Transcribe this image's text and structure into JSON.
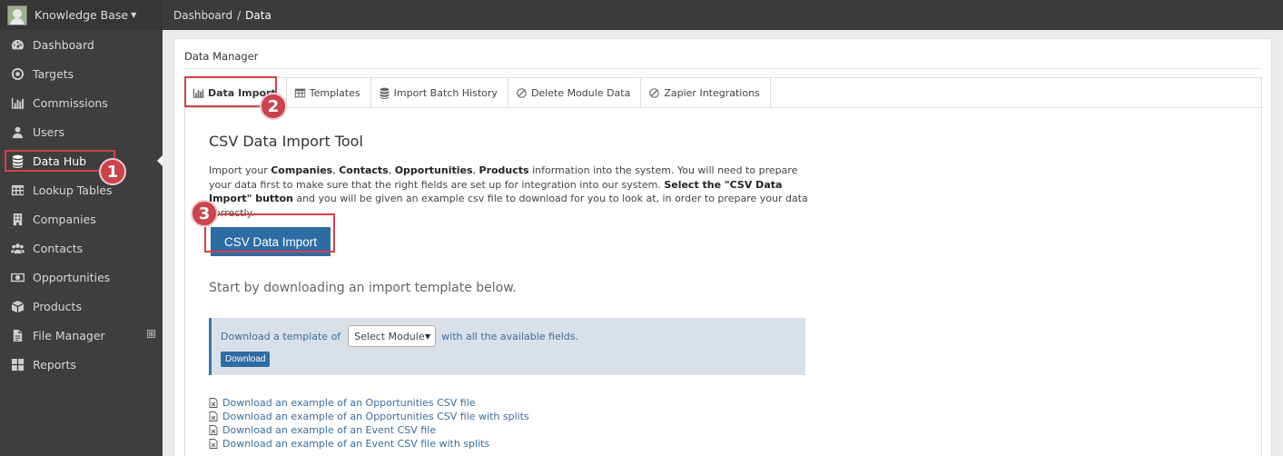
{
  "brand": {
    "name": "Knowledge Base",
    "caret_icon": "chevron-down-icon"
  },
  "breadcrumb": {
    "root": "Dashboard",
    "separator": "/",
    "current": "Data"
  },
  "sidebar": {
    "items": [
      {
        "label": "Dashboard",
        "icon": "dashboard-icon"
      },
      {
        "label": "Targets",
        "icon": "target-icon"
      },
      {
        "label": "Commissions",
        "icon": "bar-chart-icon"
      },
      {
        "label": "Users",
        "icon": "user-icon"
      },
      {
        "label": "Data Hub",
        "icon": "database-icon",
        "active": true
      },
      {
        "label": "Lookup Tables",
        "icon": "table-icon"
      },
      {
        "label": "Companies",
        "icon": "building-icon"
      },
      {
        "label": "Contacts",
        "icon": "users-icon"
      },
      {
        "label": "Opportunities",
        "icon": "money-icon"
      },
      {
        "label": "Products",
        "icon": "box-icon"
      },
      {
        "label": "File Manager",
        "icon": "file-icon",
        "expand": "⊞"
      },
      {
        "label": "Reports",
        "icon": "grid-icon"
      }
    ]
  },
  "panel": {
    "title": "Data Manager"
  },
  "tabs": [
    {
      "label": "Data Import",
      "icon": "bar-chart-icon",
      "active": true
    },
    {
      "label": "Templates",
      "icon": "table-icon"
    },
    {
      "label": "Import Batch History",
      "icon": "database-icon"
    },
    {
      "label": "Delete Module Data",
      "icon": "ban-icon"
    },
    {
      "label": "Zapier Integrations",
      "icon": "ban-icon"
    }
  ],
  "tool": {
    "title": "CSV Data Import Tool",
    "intro": {
      "p1": "Import your ",
      "b1": "Companies",
      "s1": ", ",
      "b2": "Contacts",
      "s2": ", ",
      "b3": "Opportunities",
      "s3": ", ",
      "b4": "Products",
      "p2": " information into the system. You will need to prepare your data first to make sure that the right fields are set up for integration into our system. ",
      "b5": "Select the \"CSV Data Import\" button",
      "p3": " and you will be given an example csv file to download for you to look at, in order to prepare your data correctly."
    },
    "import_button": "CSV Data Import",
    "start_text": "Start by downloading an import template below."
  },
  "template": {
    "prefix": "Download a template of",
    "select_value": "Select Module",
    "suffix": "with all the available fields.",
    "download_button": "Download"
  },
  "example_links": [
    "Download an example of an Opportunities CSV file",
    "Download an example of an Opportunities CSV file with splits",
    "Download an example of an Event CSV file",
    "Download an example of an Event CSV file with splits"
  ],
  "annotations": {
    "step1": "1",
    "step2": "2",
    "step3": "3",
    "color": "#d0414c"
  },
  "colors": {
    "primary": "#2e6ca4",
    "sidebar": "#3e3e3e",
    "link": "#3a6e9e",
    "template_bg": "#d9e0ea"
  }
}
